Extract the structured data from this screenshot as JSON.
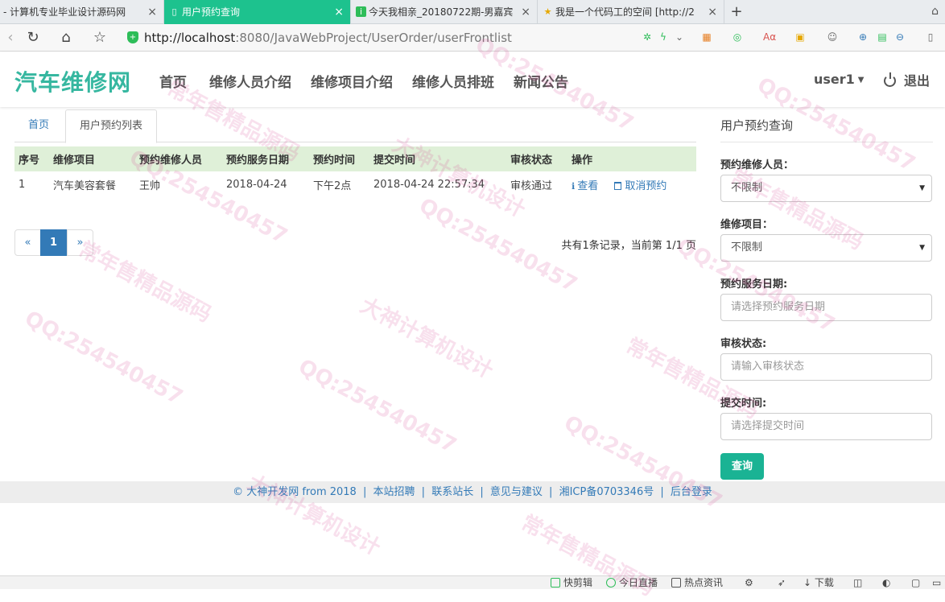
{
  "browser": {
    "tabs": [
      {
        "title": "- 计算机专业毕业设计源码网",
        "close": "×"
      },
      {
        "title": "用户预约查询",
        "close": "×"
      },
      {
        "title": "今天我相亲_20180722期-男嘉宾",
        "close": "×"
      },
      {
        "title": "我是一个代码工的空间 [http://2",
        "close": "×"
      }
    ],
    "new_tab": "+",
    "url_host": "http://localhost",
    "url_rest": ":8080/JavaWebProject/UserOrder/userFrontlist"
  },
  "header": {
    "logo": "汽车维修网",
    "nav": [
      "首页",
      "维修人员介绍",
      "维修项目介绍",
      "维修人员排班",
      "新闻公告"
    ],
    "user": "user1",
    "logout": "退出"
  },
  "breadcrumb": {
    "home": "首页",
    "current": "用户预约列表"
  },
  "table": {
    "headers": [
      "序号",
      "维修项目",
      "预约维修人员",
      "预约服务日期",
      "预约时间",
      "提交时间",
      "审核状态",
      "操作"
    ],
    "rows": [
      {
        "index": "1",
        "item": "汽车美容套餐",
        "staff": "王帅",
        "service_date": "2018-04-24",
        "time": "下午2点",
        "submit_time": "2018-04-24 22:57:34",
        "status": "审核通过",
        "view": "查看",
        "cancel": "取消预约"
      }
    ]
  },
  "pagination": {
    "prev": "«",
    "current": "1",
    "next": "»",
    "info": "共有1条记录，当前第 1/1 页"
  },
  "search": {
    "title": "用户预约查询",
    "staff_label": "预约维修人员：",
    "staff_value": "不限制",
    "item_label": "维修项目：",
    "item_value": "不限制",
    "date_label": "预约服务日期:",
    "date_placeholder": "请选择预约服务日期",
    "status_label": "审核状态:",
    "status_placeholder": "请输入审核状态",
    "submit_label": "提交时间:",
    "submit_placeholder": "请选择提交时间",
    "button": "查询"
  },
  "footer": {
    "copyright": "© 大神开发网 from 2018",
    "links": [
      "本站招聘",
      "联系站长",
      "意见与建议",
      "湘ICP备0703346号",
      "后台登录"
    ]
  },
  "statusbar": {
    "items": [
      "快剪辑",
      "今日直播",
      "热点资讯",
      "下载"
    ]
  },
  "watermark": {
    "qq": "QQ:254540457",
    "design": "大神计算机设计",
    "shop": "常年售精品源码"
  }
}
